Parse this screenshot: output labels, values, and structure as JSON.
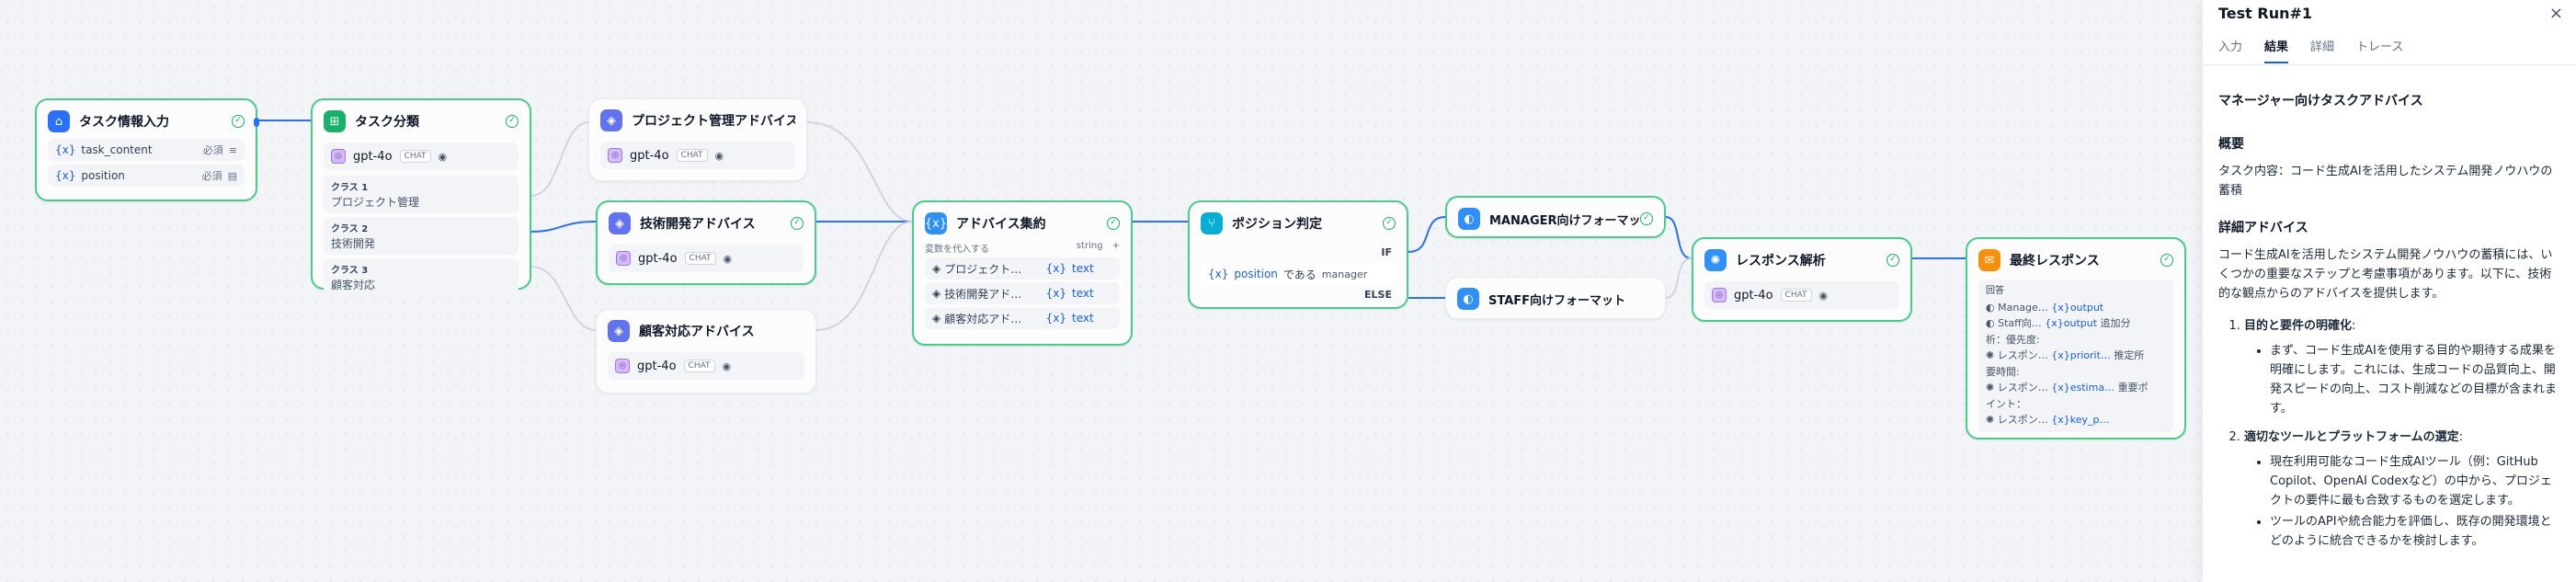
{
  "nodes": {
    "task_input": {
      "title": "タスク情報入力",
      "vars": [
        {
          "name": "task_content",
          "required": "必須"
        },
        {
          "name": "position",
          "required": "必須"
        }
      ]
    },
    "task_classify": {
      "title": "タスク分類",
      "model": "gpt-4o",
      "mode": "CHAT",
      "classes": [
        {
          "key": "クラス 1",
          "value": "プロジェクト管理"
        },
        {
          "key": "クラス 2",
          "value": "技術開発"
        },
        {
          "key": "クラス 3",
          "value": "顧客対応"
        }
      ]
    },
    "pm_advice": {
      "title": "プロジェクト管理アドバイス",
      "model": "gpt-4o",
      "mode": "CHAT"
    },
    "tech_advice": {
      "title": "技術開発アドバイス",
      "model": "gpt-4o",
      "mode": "CHAT"
    },
    "cs_advice": {
      "title": "顧客対応アドバイス",
      "model": "gpt-4o",
      "mode": "CHAT"
    },
    "aggregate": {
      "title": "アドバイス集約",
      "assign_label": "変数を代入する",
      "type_label": "string",
      "plus": "+",
      "rows": [
        {
          "name": "プロジェクト…",
          "value": "text"
        },
        {
          "name": "技術開発アド…",
          "value": "text"
        },
        {
          "name": "顧客対応アド…",
          "value": "text"
        }
      ]
    },
    "position_judge": {
      "title": "ポジション判定",
      "if_label": "IF",
      "cond_var": "position",
      "cond_op": "である",
      "cond_value": "manager",
      "else_label": "ELSE"
    },
    "manager_fmt": {
      "title": "MANAGER向けフォーマット"
    },
    "staff_fmt": {
      "title": "STAFF向けフォーマット"
    },
    "resp_parse": {
      "title": "レスポンス解析",
      "model": "gpt-4o",
      "mode": "CHAT"
    },
    "final_resp": {
      "title": "最終レスポンス",
      "label": "回答",
      "lines": [
        {
          "name": "Manage…",
          "var": "output",
          "tail": ""
        },
        {
          "name": "Staff向…",
          "var": "output",
          "tail": "追加分"
        },
        {
          "name": "析：優先度:",
          "var": "",
          "tail": ""
        },
        {
          "name": "レスポン…",
          "var": "priorit…",
          "tail": "推定所"
        },
        {
          "name": "要時間:",
          "var": "",
          "tail": ""
        },
        {
          "name": "レスポン…",
          "var": "estima…",
          "tail": "重要ポ"
        },
        {
          "name": "イント：",
          "var": "",
          "tail": ""
        },
        {
          "name": "レスポン…",
          "var": "key_p…",
          "tail": ""
        }
      ]
    }
  },
  "panel": {
    "title": "Test Run#1",
    "close": "×",
    "tabs": [
      "入力",
      "結果",
      "詳細",
      "トレース"
    ],
    "active_tab": "結果",
    "result": {
      "heading": "マネージャー向けタスクアドバイス",
      "overview_title": "概要",
      "overview_text": "タスク内容：コード生成AIを活用したシステム開発ノウハウの蓄積",
      "detail_title": "詳細アドバイス",
      "detail_text": "コード生成AIを活用したシステム開発ノウハウの蓄積には、いくつかの重要なステップと考慮事項があります。以下に、技術的な観点からのアドバイスを提供します。",
      "items": [
        {
          "title": "目的と要件の明確化",
          "suffix": ":",
          "bullets": [
            "まず、コード生成AIを使用する目的や期待する成果を明確にします。これには、生成コードの品質向上、開発スピードの向上、コスト削減などの目標が含まれます。"
          ]
        },
        {
          "title": "適切なツールとプラットフォームの選定",
          "suffix": ":",
          "bullets": [
            "現在利用可能なコード生成AIツール（例：GitHub Copilot、OpenAI Codexなど）の中から、プロジェクトの要件に最も合致するものを選定します。",
            "ツールのAPIや統合能力を評価し、既存の開発環境とどのように統合できるかを検討します。"
          ]
        }
      ]
    }
  }
}
